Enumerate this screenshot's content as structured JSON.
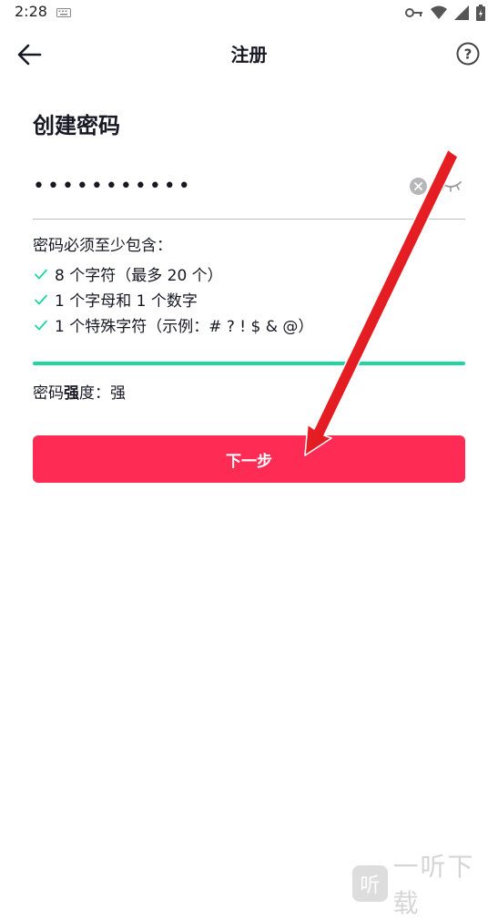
{
  "status_bar": {
    "time": "2:28",
    "icons": [
      "keyboard-icon",
      "key-icon",
      "wifi-icon",
      "signal-icon",
      "battery-icon"
    ]
  },
  "header": {
    "title": "注册"
  },
  "form": {
    "section_title": "创建密码",
    "password_value": "•••••••••••",
    "rules_label": "密码必须至少包含：",
    "rules": [
      "8 个字符（最多 20 个）",
      "1 个字母和 1 个数字",
      "1 个特殊字符（示例：# ? ! $ & @）"
    ],
    "strength_label_pre": "密码",
    "strength_label_bold": "强",
    "strength_label_post": "度：",
    "strength_value": "强",
    "strength_level": 1.0,
    "next_button": "下一步"
  },
  "colors": {
    "accent": "#fe2c55",
    "check": "#20d5a0",
    "strength_bar": "#20d5a0",
    "annotation_arrow": "#e8141e"
  },
  "watermark": {
    "logo_char": "听",
    "text": "一听下载"
  }
}
